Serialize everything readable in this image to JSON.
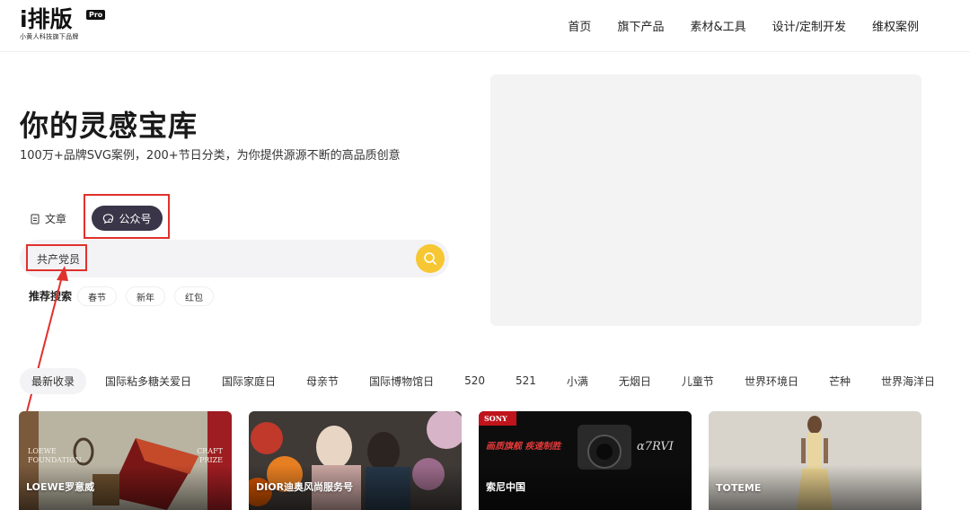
{
  "header": {
    "logo_main": "i排版",
    "logo_badge": "Pro",
    "logo_sub": "小黄人科技旗下品牌",
    "nav": [
      "首页",
      "旗下产品",
      "素材&工具",
      "设计/定制开发",
      "维权案例"
    ]
  },
  "hero": {
    "title": "你的灵感宝库",
    "subtitle": "100万+品牌SVG案例，200+节日分类，为你提供源源不断的高品质创意"
  },
  "tabs": {
    "article": "文章",
    "official_account": "公众号",
    "active": "公众号"
  },
  "search": {
    "value": "共产党员",
    "button_icon": "search-icon"
  },
  "recommended": {
    "label": "推荐搜索",
    "tags": [
      "春节",
      "新年",
      "红包"
    ]
  },
  "categories": [
    "最新收录",
    "国际粘多糖关爱日",
    "国际家庭日",
    "母亲节",
    "国际博物馆日",
    "520",
    "521",
    "小满",
    "无烟日",
    "儿童节",
    "世界环境日",
    "芒种",
    "世界海洋日"
  ],
  "active_category": "最新收录",
  "cards": [
    {
      "label": "LOEWE罗意威",
      "overlay": [
        "LOEWE",
        "FOUNDATION"
      ],
      "overlay_right": [
        "CRAFT",
        "PRIZE"
      ]
    },
    {
      "label": "DIOR迪奥风尚服务号"
    },
    {
      "label": "索尼中国",
      "brand": "SONY",
      "headline": "画质旗舰 疾速制胜",
      "model": "α7RVI"
    },
    {
      "label": "TOTEME"
    }
  ],
  "colors": {
    "accent": "#f6c733",
    "tab_active_bg": "#3a3548",
    "annotation_red": "#e0302c"
  }
}
